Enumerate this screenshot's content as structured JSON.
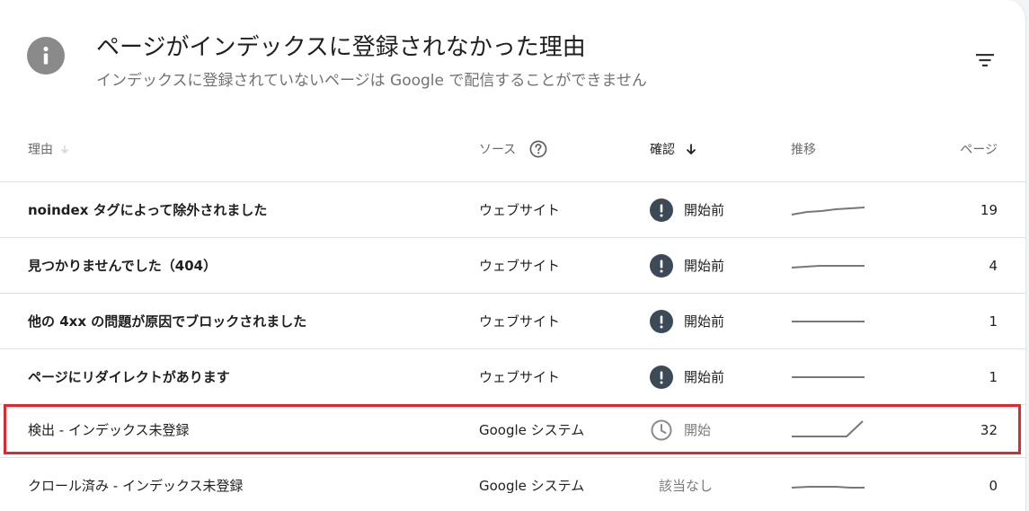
{
  "header": {
    "title": "ページがインデックスに登録されなかった理由",
    "subtitle": "インデックスに登録されていないページは Google で配信することができません"
  },
  "columns": {
    "reason": "理由",
    "source": "ソース",
    "confirm": "確認",
    "trend": "推移",
    "pages": "ページ"
  },
  "icons": {
    "info": "info-icon",
    "filter": "filter-icon",
    "help": "help-icon",
    "sort": "arrow-down-icon",
    "alert": "exclamation-icon",
    "clock": "clock-icon"
  },
  "colors": {
    "highlight": "#e0262e",
    "status_badge": "#3c4a57",
    "sparkline": "#777777"
  },
  "rows": [
    {
      "reason": "noindex タグによって除外されました",
      "source": "ウェブサイト",
      "status": "開始前",
      "pages": "19"
    },
    {
      "reason": "見つかりませんでした（404）",
      "source": "ウェブサイト",
      "status": "開始前",
      "pages": "4"
    },
    {
      "reason": "他の 4xx の問題が原因でブロックされました",
      "source": "ウェブサイト",
      "status": "開始前",
      "pages": "1"
    },
    {
      "reason": "ページにリダイレクトがあります",
      "source": "ウェブサイト",
      "status": "開始前",
      "pages": "1"
    },
    {
      "reason": "検出 - インデックス未登録",
      "source": "Google システム",
      "status": "開始",
      "pages": "32"
    },
    {
      "reason": "クロール済み - インデックス未登録",
      "source": "Google システム",
      "status": "該当なし",
      "pages": "0"
    }
  ]
}
